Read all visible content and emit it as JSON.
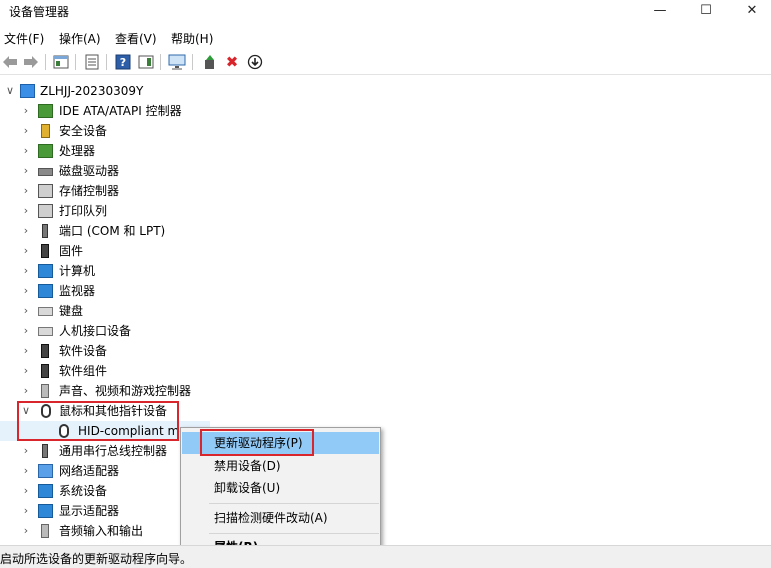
{
  "window": {
    "title": "设备管理器",
    "minimize_glyph": "—",
    "maximize_glyph": "☐",
    "close_glyph": "✕"
  },
  "menu": {
    "items": [
      "文件(F)",
      "操作(A)",
      "查看(V)",
      "帮助(H)"
    ]
  },
  "toolbar": {
    "back_icon": "arrow-left-icon",
    "forward_icon": "arrow-right-icon",
    "remove_glyph": "✖",
    "enable_glyph": "⬇",
    "help_glyph": "?"
  },
  "tree": {
    "expanded_glyph": "∨",
    "collapsed_glyph": "›",
    "root": "ZLHJJ-20230309Y",
    "categories": [
      "IDE ATA/ATAPI 控制器",
      "安全设备",
      "处理器",
      "磁盘驱动器",
      "存储控制器",
      "打印队列",
      "端口 (COM 和 LPT)",
      "固件",
      "计算机",
      "监视器",
      "键盘",
      "人机接口设备",
      "软件设备",
      "软件组件",
      "声音、视频和游戏控制器",
      "鼠标和其他指针设备",
      "通用串行总线控制器",
      "网络适配器",
      "系统设备",
      "显示适配器",
      "音频输入和输出"
    ],
    "child_of_mouse": "HID-compliant mouse"
  },
  "context_menu": {
    "items": [
      "更新驱动程序(P)",
      "禁用设备(D)",
      "卸载设备(U)",
      "扫描检测硬件改动(A)",
      "属性(R)"
    ]
  },
  "status": {
    "text": "启动所选设备的更新驱动程序向导。"
  },
  "colors": {
    "highlight_red": "#d8262c",
    "menu_active": "#91c9f7"
  }
}
